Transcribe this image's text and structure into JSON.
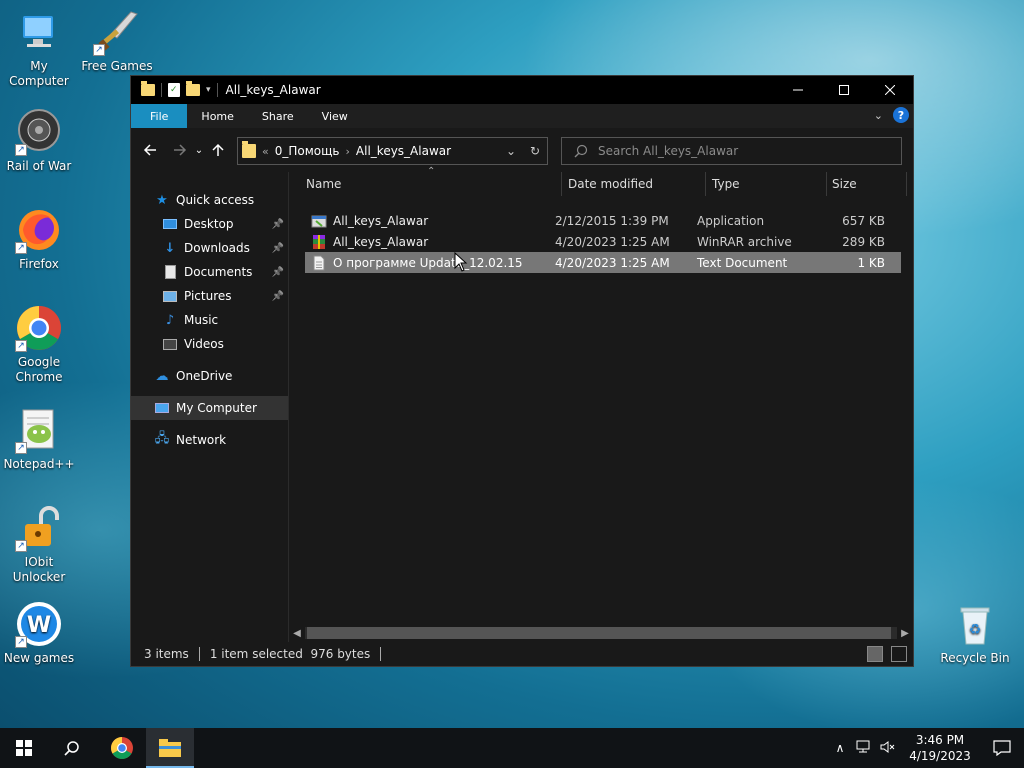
{
  "desktop": {
    "icons": [
      {
        "label": "My Computer"
      },
      {
        "label": "Free Games"
      },
      {
        "label": "Rail of War"
      },
      {
        "label": "Firefox"
      },
      {
        "label": "Google Chrome"
      },
      {
        "label": "Notepad++"
      },
      {
        "label": "IObit Unlocker"
      },
      {
        "label": "New games"
      },
      {
        "label": "Recycle Bin"
      }
    ]
  },
  "window": {
    "title": "All_keys_Alawar",
    "ribbon_tabs": [
      "File",
      "Home",
      "Share",
      "View"
    ],
    "address": {
      "overflow": "«",
      "crumbs": [
        "0_Помощь",
        "All_keys_Alawar"
      ]
    },
    "search": {
      "placeholder": "Search All_keys_Alawar"
    },
    "nav": [
      {
        "label": "Quick access",
        "icon": "star-icon",
        "pinned": false,
        "indent": 0
      },
      {
        "label": "Desktop",
        "icon": "desktop-icon",
        "pinned": true,
        "indent": 1
      },
      {
        "label": "Downloads",
        "icon": "download-icon",
        "pinned": true,
        "indent": 1
      },
      {
        "label": "Documents",
        "icon": "document-icon",
        "pinned": true,
        "indent": 1
      },
      {
        "label": "Pictures",
        "icon": "pictures-icon",
        "pinned": true,
        "indent": 1
      },
      {
        "label": "Music",
        "icon": "music-icon",
        "pinned": false,
        "indent": 1
      },
      {
        "label": "Videos",
        "icon": "videos-icon",
        "pinned": false,
        "indent": 1
      },
      {
        "label": "OneDrive",
        "icon": "cloud-icon",
        "pinned": false,
        "indent": 0
      },
      {
        "label": "My Computer",
        "icon": "computer-icon",
        "pinned": false,
        "indent": 0,
        "selected": true
      },
      {
        "label": "Network",
        "icon": "network-icon",
        "pinned": false,
        "indent": 0
      }
    ],
    "columns": [
      "Name",
      "Date modified",
      "Type",
      "Size"
    ],
    "files": [
      {
        "name": "All_keys_Alawar",
        "date": "2/12/2015 1:39 PM",
        "type": "Application",
        "size": "657 KB",
        "icon": "application-icon",
        "selected": false
      },
      {
        "name": "All_keys_Alawar",
        "date": "4/20/2023 1:25 AM",
        "type": "WinRAR archive",
        "size": "289 KB",
        "icon": "winrar-icon",
        "selected": false
      },
      {
        "name": "О программе Update_12.02.15",
        "date": "4/20/2023 1:25 AM",
        "type": "Text Document",
        "size": "1 KB",
        "icon": "text-file-icon",
        "selected": true
      }
    ],
    "status": {
      "items_count": "3 items",
      "selection": "1 item selected  976 bytes"
    }
  },
  "taskbar": {
    "time": "3:46 PM",
    "date": "4/19/2023"
  }
}
